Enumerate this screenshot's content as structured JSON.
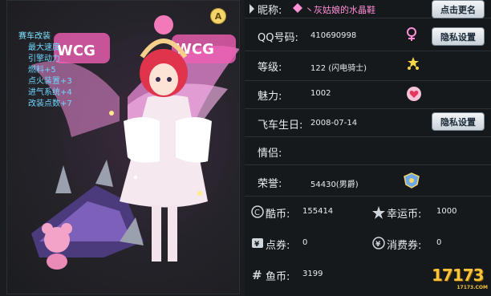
{
  "avatar": {
    "stats": {
      "title": "赛车改装",
      "lines": [
        "最大速度",
        "引擎动力",
        "燃料+5",
        "点火装置+3",
        "进气系统+4",
        "改装点数+7"
      ]
    },
    "badge": "A"
  },
  "profile": {
    "nickname_label": "昵称:",
    "nickname_value": "丶灰姑娘的水晶鞋",
    "rename_button": "点击更名",
    "qq_label": "QQ号码:",
    "qq_value": "410690998",
    "privacy_button_1": "隐私设置",
    "level_label": "等级:",
    "level_value": "122 (闪电骑士)",
    "charm_label": "魅力:",
    "charm_value": "1002",
    "birthday_label": "飞车生日:",
    "birthday_value": "2008-07-14",
    "privacy_button_2": "隐私设置",
    "partner_label": "情侣:",
    "honor_label": "荣誉:",
    "honor_value": "54430(男爵)"
  },
  "currency": {
    "cool_coin_label": "酷币:",
    "cool_coin_value": "155414",
    "lucky_coin_label": "幸运币:",
    "lucky_coin_value": "1000",
    "voucher_label": "点券:",
    "voucher_value": "0",
    "consume_label": "消费券:",
    "consume_value": "0",
    "fish_coin_label": "鱼币:",
    "fish_coin_value": "3199"
  },
  "watermark": {
    "text": "17173",
    "sub": "17173.COM"
  },
  "colors": {
    "stats_text": "#6fd6ff",
    "nickname_pink": "#ff8fd6",
    "panel_bg": "#16191c"
  }
}
